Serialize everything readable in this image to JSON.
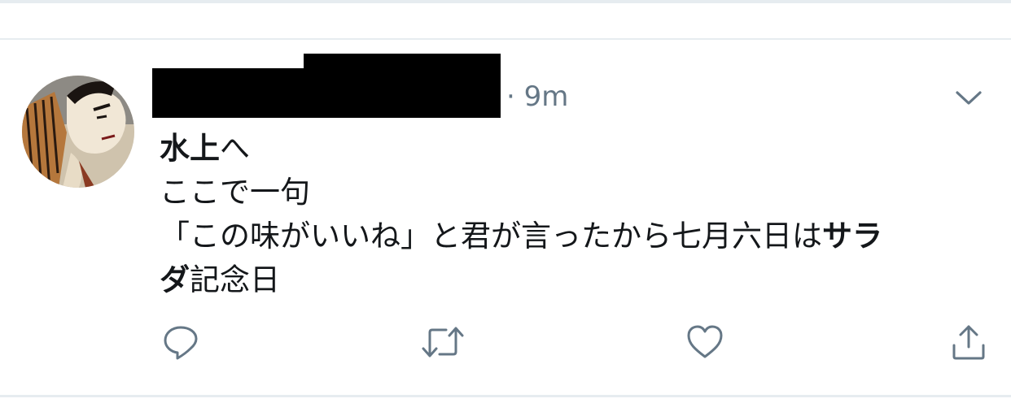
{
  "tweet": {
    "author_redacted": true,
    "separator": "·",
    "timestamp": "9m",
    "text": {
      "line1_bold": "水上",
      "line1_rest": "へ",
      "line2": "ここで一句",
      "line3_plain": "「この味がいいね」と君が言ったから七月六日は",
      "line3_bold": "サラ",
      "line4_bold": "ダ",
      "line4_rest": "記念日"
    }
  },
  "icons": {
    "menu": "chevron-down-icon",
    "reply": "reply-icon",
    "retweet": "retweet-icon",
    "like": "like-icon",
    "share": "share-icon"
  },
  "colors": {
    "text": "#14171a",
    "secondary": "#657786",
    "divider": "#e6ecf0"
  }
}
